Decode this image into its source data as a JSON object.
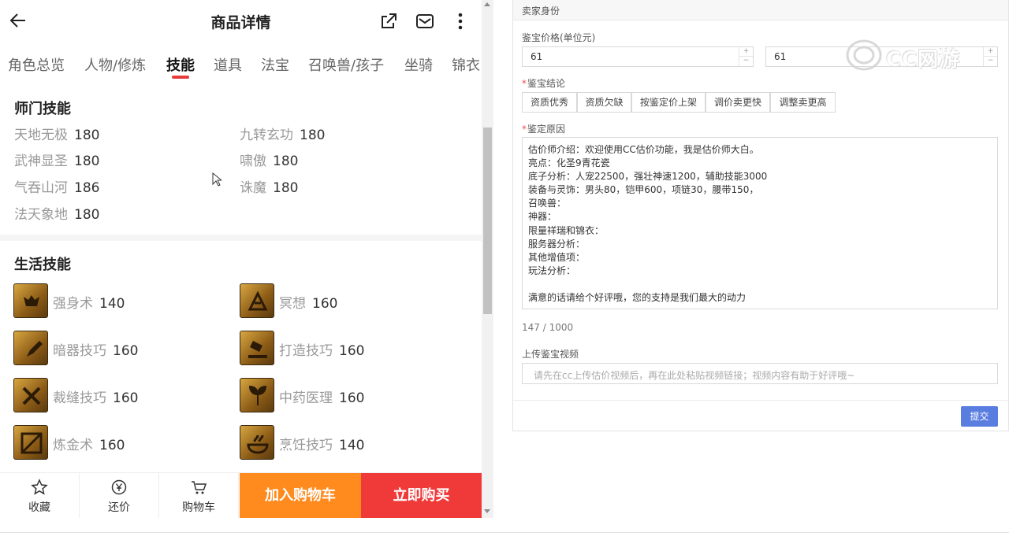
{
  "header": {
    "title": "商品详情"
  },
  "tabs": [
    {
      "label": "角色总览"
    },
    {
      "label": "人物/修炼"
    },
    {
      "label": "技能",
      "active": true
    },
    {
      "label": "道具"
    },
    {
      "label": "法宝"
    },
    {
      "label": "召唤兽/孩子"
    },
    {
      "label": "坐骑"
    },
    {
      "label": "锦衣"
    }
  ],
  "school_skills": {
    "title": "师门技能",
    "items": [
      {
        "name": "天地无极",
        "value": "180"
      },
      {
        "name": "九转玄功",
        "value": "180"
      },
      {
        "name": "武神显圣",
        "value": "180"
      },
      {
        "name": "啸傲",
        "value": "180"
      },
      {
        "name": "气吞山河",
        "value": "186"
      },
      {
        "name": "诛魔",
        "value": "180"
      },
      {
        "name": "法天象地",
        "value": "180"
      }
    ]
  },
  "life_skills": {
    "title": "生活技能",
    "items": [
      {
        "name": "强身术",
        "value": "140",
        "icon": "strength-skill-icon"
      },
      {
        "name": "冥想",
        "value": "160",
        "icon": "meditation-skill-icon"
      },
      {
        "name": "暗器技巧",
        "value": "160",
        "icon": "dart-skill-icon"
      },
      {
        "name": "打造技巧",
        "value": "160",
        "icon": "forging-skill-icon"
      },
      {
        "name": "裁缝技巧",
        "value": "160",
        "icon": "tailoring-skill-icon"
      },
      {
        "name": "中药医理",
        "value": "160",
        "icon": "herbal-medicine-skill-icon"
      },
      {
        "name": "炼金术",
        "value": "160",
        "icon": "alchemy-skill-icon"
      },
      {
        "name": "烹饪技巧",
        "value": "140",
        "icon": "cooking-skill-icon"
      }
    ]
  },
  "bottom_bar": {
    "favorite": "收藏",
    "bargain": "还价",
    "cart": "购物车",
    "add_to_cart": "加入购物车",
    "buy_now": "立即购买"
  },
  "form": {
    "section_title": "卖家身份",
    "price_label": "鉴宝价格(单位元)",
    "price_min": "61",
    "price_max": "61",
    "conclusion_label": "鉴宝结论",
    "conclusion_options": [
      "资质优秀",
      "资质欠缺",
      "按鉴定价上架",
      "调价卖更快",
      "调整卖更高"
    ],
    "reason_label": "鉴定原因",
    "reason_text": "估价师介绍：欢迎使用CC估价功能，我是估价师大白。\n亮点：化圣9青花瓷\n底子分析：人宠22500，强壮神速1200，辅助技能3000\n装备与灵饰：男头80，铠甲600，项链30，腰带150，\n召唤兽：\n神器：\n限量祥瑞和锦衣：\n服务器分析：\n其他增值项：\n玩法分析：\n\n满意的话请给个好评哦，您的支持是我们最大的动力",
    "counter": "147 / 1000",
    "video_label": "上传鉴宝视频",
    "video_placeholder": "请先在cc上传估价视频后，再在此处粘贴视频链接；视频内容有助于好评哦~",
    "submit": "提交"
  },
  "watermark": {
    "text": "CC网游"
  },
  "colors": {
    "accent_red": "#e63b3b",
    "cart_orange": "#ff8a1e",
    "buy_red": "#f03a3a",
    "submit_blue": "#5a7de0"
  }
}
